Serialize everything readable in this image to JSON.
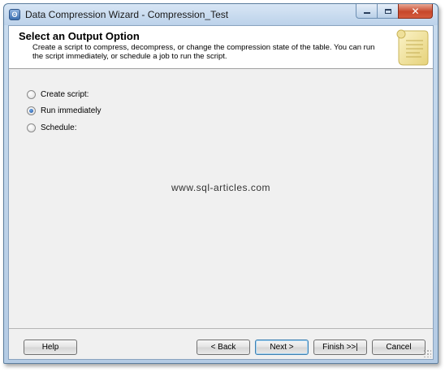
{
  "window": {
    "title": "Data Compression Wizard - Compression_Test"
  },
  "header": {
    "title": "Select an Output Option",
    "description": "Create a script to compress, decompress, or change the compression state of the table. You can run the script immediately, or schedule a job to run the script."
  },
  "options": [
    {
      "label": "Create script:",
      "checked": false
    },
    {
      "label": "Run immediately",
      "checked": true
    },
    {
      "label": "Schedule:",
      "checked": false
    }
  ],
  "watermark": "www.sql-articles.com",
  "buttons": {
    "help": "Help",
    "back": "< Back",
    "next": "Next >",
    "finish": "Finish >>|",
    "cancel": "Cancel"
  },
  "icons": {
    "app": "wizard-app-icon",
    "header": "scroll-icon",
    "minimize": "minimize-icon",
    "maximize": "maximize-icon",
    "close": "close-icon"
  },
  "colors": {
    "accent": "#3c7fb1",
    "close_button": "#c7472b",
    "scroll_parchment": "#f3e7a6"
  }
}
